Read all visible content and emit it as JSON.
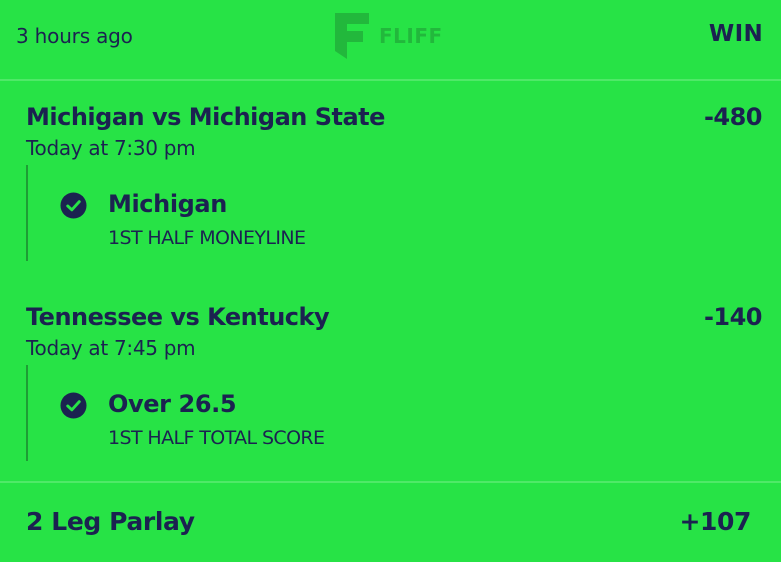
{
  "header": {
    "time_ago": "3 hours ago",
    "brand": "FLIFF",
    "result": "WIN"
  },
  "legs": [
    {
      "matchup": "Michigan vs Michigan State",
      "odds": "-480",
      "game_time": "Today at 7:30 pm",
      "pick": "Michigan",
      "market": "1ST HALF MONEYLINE",
      "status_icon": "check-circle-icon"
    },
    {
      "matchup": "Tennessee vs Kentucky",
      "odds": "-140",
      "game_time": "Today at 7:45 pm",
      "pick": "Over 26.5",
      "market": "1ST HALF TOTAL SCORE",
      "status_icon": "check-circle-icon"
    }
  ],
  "footer": {
    "parlay_label": "2 Leg Parlay",
    "parlay_odds": "+107"
  },
  "colors": {
    "background": "#27e346",
    "text": "#1b2250",
    "divider": "#4fe968"
  }
}
